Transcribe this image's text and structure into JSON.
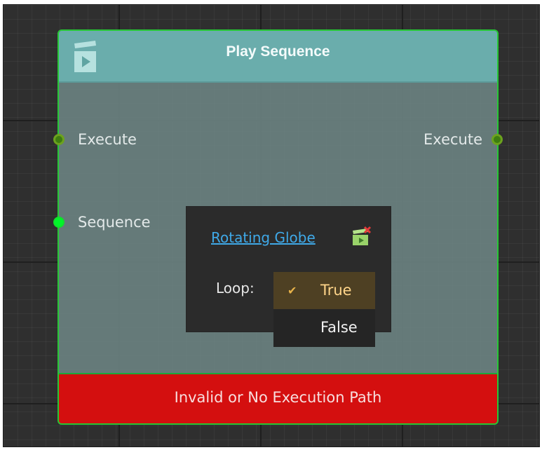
{
  "node": {
    "title": "Play Sequence",
    "icon": "clapperboard-play-icon",
    "inputs": {
      "execute": "Execute",
      "sequence": "Sequence"
    },
    "outputs": {
      "execute": "Execute"
    },
    "status": "Invalid or No Execution Path"
  },
  "popup": {
    "asset_link": "Rotating Globe",
    "asset_icon": "sequence-asset-icon",
    "loop_label": "Loop:",
    "loop_options": [
      "True",
      "False"
    ],
    "loop_selected": "True"
  },
  "colors": {
    "node_border": "#27c735",
    "header": "#6aadac",
    "error": "#d40f0f",
    "link": "#3fa9e8",
    "exec_port": "#3d7d10",
    "sequence_port": "#00f529"
  }
}
